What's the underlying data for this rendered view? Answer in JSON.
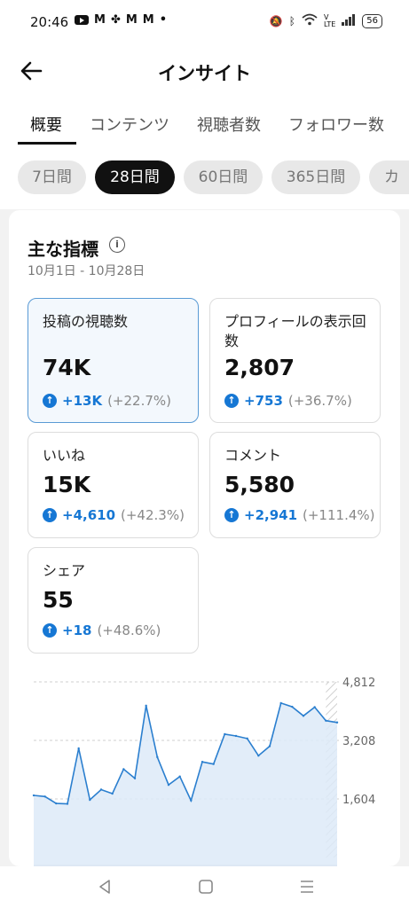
{
  "status_bar": {
    "time": "20:46",
    "battery": "56",
    "app_icons": [
      "youtube-icon",
      "gmail-icon",
      "pinwheel-icon",
      "gmail-icon",
      "gmail-icon",
      "dot"
    ],
    "system_icons": [
      "mute-icon",
      "bluetooth-icon",
      "wifi-icon",
      "volte-icon",
      "signal-icon",
      "battery-icon"
    ]
  },
  "header": {
    "title": "インサイト"
  },
  "tabs": [
    {
      "label": "概要",
      "active": true
    },
    {
      "label": "コンテンツ"
    },
    {
      "label": "視聴者数"
    },
    {
      "label": "フォロワー数"
    }
  ],
  "periods": [
    {
      "label": "7日間"
    },
    {
      "label": "28日間",
      "active": true
    },
    {
      "label": "60日間"
    },
    {
      "label": "365日間"
    },
    {
      "label": "カ"
    }
  ],
  "summary": {
    "title": "主な指標",
    "date_range": "10月1日 - 10月28日",
    "metrics": [
      {
        "label": "投稿の視聴数",
        "value": "74K",
        "delta": "+13K",
        "pct": "(+22.7%)",
        "selected": true
      },
      {
        "label": "プロフィールの表示回数",
        "value": "2,807",
        "delta": "+753",
        "pct": "(+36.7%)"
      },
      {
        "label": "いいね",
        "value": "15K",
        "delta": "+4,610",
        "pct": "(+42.3%)"
      },
      {
        "label": "コメント",
        "value": "5,580",
        "delta": "+2,941",
        "pct": "(+111.4%)"
      },
      {
        "label": "シェア",
        "value": "55",
        "delta": "+18",
        "pct": "(+48.6%)"
      }
    ]
  },
  "chart_data": {
    "type": "area",
    "y_ticks": [
      "4,812",
      "3,208",
      "1,604"
    ],
    "ylim": [
      0,
      4812
    ],
    "x": [
      1,
      2,
      3,
      4,
      5,
      6,
      7,
      8,
      9,
      10,
      11,
      12,
      13,
      14,
      15,
      16,
      17,
      18,
      19,
      20,
      21,
      22,
      23,
      24,
      25,
      26,
      27,
      28
    ],
    "values": [
      1700,
      1670,
      1480,
      1470,
      2990,
      1580,
      1860,
      1750,
      2420,
      2170,
      4160,
      2750,
      1990,
      2220,
      1560,
      2620,
      2560,
      3380,
      3330,
      3260,
      2790,
      3050,
      4230,
      4130,
      3880,
      4120,
      3750,
      3700
    ],
    "shaded_tail": true,
    "line_color": "#2b7fcf",
    "fill_color": "#ddeaf8"
  },
  "nav_bar": {
    "buttons": [
      "back-nav-icon",
      "home-nav-icon",
      "recents-nav-icon"
    ]
  }
}
